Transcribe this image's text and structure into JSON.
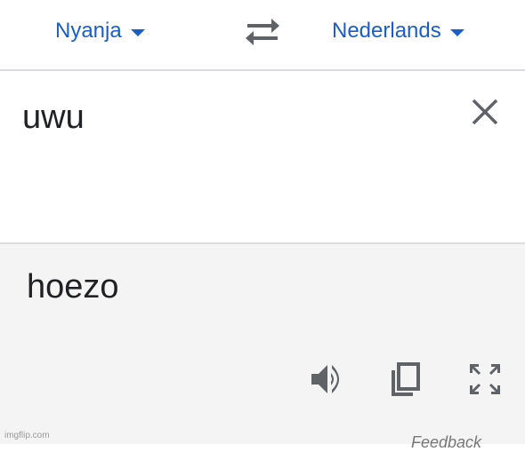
{
  "language_bar": {
    "source_language": "Nyanja",
    "target_language": "Nederlands",
    "swap_icon": "swap-arrows-icon",
    "dropdown_icon": "caret-down-icon"
  },
  "input": {
    "text": "uwu",
    "clear_icon": "close-icon"
  },
  "output": {
    "text": "hoezo",
    "actions": [
      "speaker-icon",
      "copy-icon",
      "fullscreen-icon"
    ]
  },
  "footer": {
    "feedback_label": "Feedback",
    "watermark": "imgflip.com"
  },
  "colors": {
    "accent": "#1a5fc9",
    "icon_gray": "#5f6368",
    "output_background": "#f4f4f5",
    "divider": "#dadce0"
  }
}
